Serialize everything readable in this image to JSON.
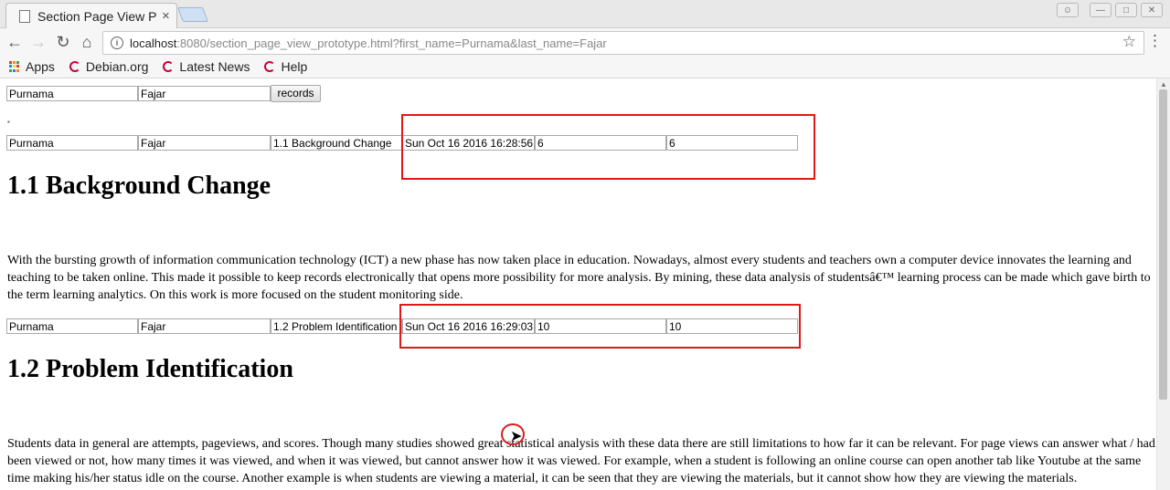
{
  "browser": {
    "tab_title": "Section Page View Prototype",
    "tab_close": "×",
    "url_host": "localhost",
    "url_rest": ":8080/section_page_view_prototype.html?first_name=Purnama&last_name=Fajar",
    "bookmarks": [
      "Apps",
      "Debian.org",
      "Latest News",
      "Help"
    ]
  },
  "form": {
    "first_name": "Purnama",
    "last_name": "Fajar",
    "records_button": "records"
  },
  "log_rows": [
    {
      "first": "Purnama",
      "last": "Fajar",
      "section": "1.1 Background Change",
      "time": "Sun Oct 16 2016 16:28:56",
      "v1": "6",
      "v2": "6"
    },
    {
      "first": "Purnama",
      "last": "Fajar",
      "section": "1.2 Problem Identification",
      "time": "Sun Oct 16 2016 16:29:03",
      "v1": "10",
      "v2": "10"
    }
  ],
  "sections": [
    {
      "heading": "1.1 Background Change",
      "text": "With the bursting growth of information communication technology (ICT) a new phase has now taken place in education. Nowadays, almost every students and teachers own a computer device innovates the learning and teaching to be taken online. This made it possible to keep records electronically that opens more possibility for more analysis. By mining, these data analysis of studentsâ€™ learning process can be made which gave birth to the term learning analytics. On this work is more focused on the student monitoring side."
    },
    {
      "heading": "1.2 Problem Identification",
      "text": "Students data in general are attempts, pageviews, and scores. Though many studies showed great statistical analysis with these data there are still limitations to how far it can be relevant. For page views can answer what / had been viewed or not, how many times it was viewed, and when it was viewed, but cannot answer how it was viewed. For example, when a student is following an online course can open another tab like Youtube at the same time making his/her status idle on the course. Another example is when students are viewing a material, it can be seen that they are viewing the materials, but it cannot show how they are viewing the materials."
    }
  ],
  "colors": {
    "highlight": "#e01818",
    "debian": "#c70036"
  }
}
